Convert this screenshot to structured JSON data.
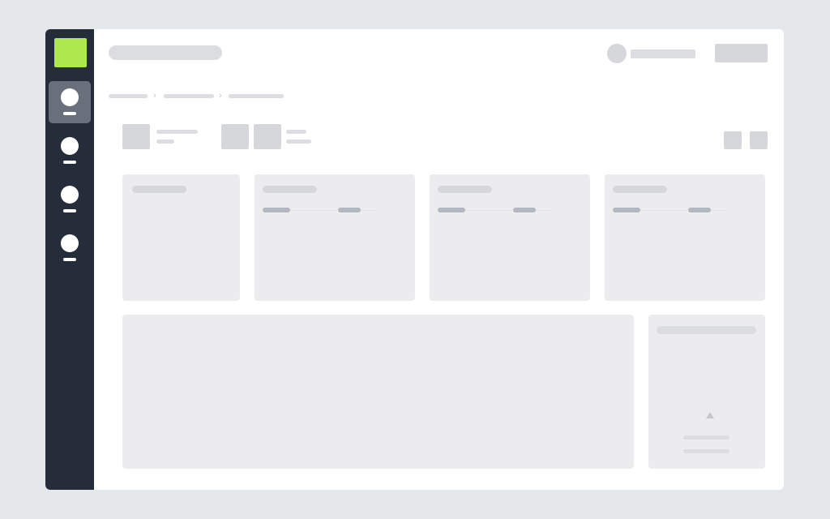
{
  "theme": {
    "sidebar_bg": "#252d3b",
    "logo_color": "#aee84e",
    "active_nav_bg": "#6a707b",
    "placeholder": "#d6d7db",
    "card_bg": "#ececee"
  },
  "sidebar": {
    "items": [
      {
        "name": "nav-item-1",
        "icon": "circle-icon",
        "active": true
      },
      {
        "name": "nav-item-2",
        "icon": "circle-icon",
        "active": false
      },
      {
        "name": "nav-item-3",
        "icon": "circle-icon",
        "active": false
      },
      {
        "name": "nav-item-4",
        "icon": "circle-icon",
        "active": false
      }
    ]
  },
  "breadcrumb": {
    "separator": "›"
  },
  "toolbar": {
    "view_icons": [
      "view-toggle-icon",
      "view-toggle-icon"
    ]
  },
  "chart_up_icon": "triangle-up-icon"
}
